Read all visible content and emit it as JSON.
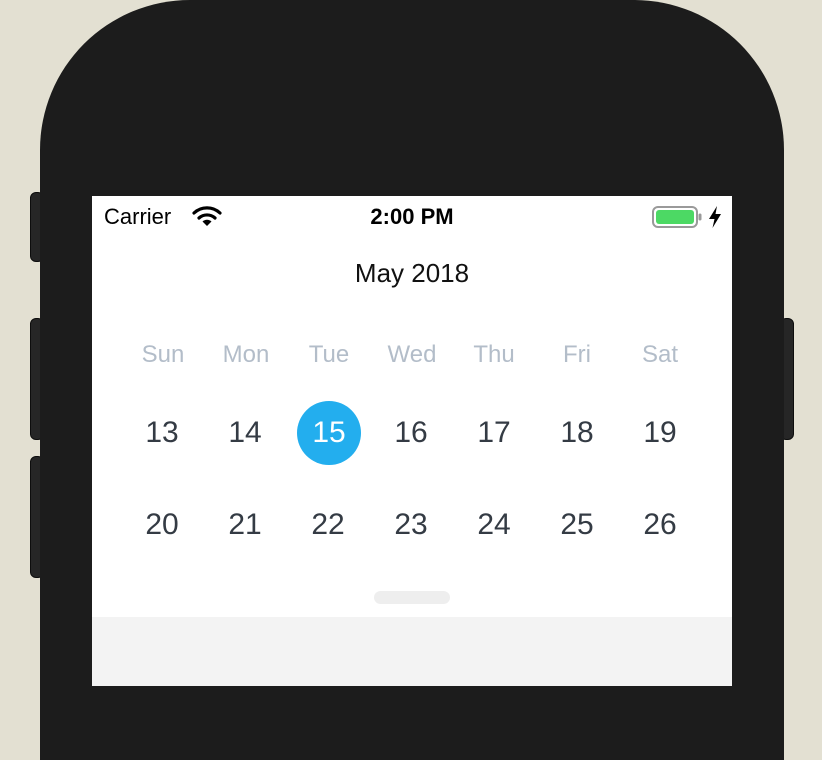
{
  "status_bar": {
    "carrier": "Carrier",
    "time": "2:00 PM",
    "icons": [
      "wifi-icon",
      "battery-icon",
      "charging-icon"
    ],
    "battery_color": "#4cd964"
  },
  "calendar": {
    "month_title": "May 2018",
    "weekdays": [
      "Sun",
      "Mon",
      "Tue",
      "Wed",
      "Thu",
      "Fri",
      "Sat"
    ],
    "week1": [
      "13",
      "14",
      "15",
      "16",
      "17",
      "18",
      "19"
    ],
    "week2": [
      "20",
      "21",
      "22",
      "23",
      "24",
      "25",
      "26"
    ],
    "selected_day": "15",
    "accent_color": "#23aeee"
  }
}
